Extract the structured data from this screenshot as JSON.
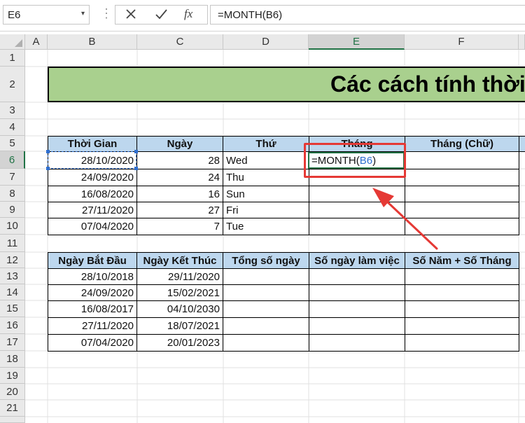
{
  "formula_bar": {
    "name_box": "E6",
    "name_box_dropdown": "▾",
    "separator_dots": "⋮",
    "cancel_icon": "x-icon",
    "enter_icon": "check-icon",
    "fx_label": "fx",
    "formula": "=MONTH(B6)"
  },
  "columns": [
    "A",
    "B",
    "C",
    "D",
    "E",
    "F"
  ],
  "rows": [
    "1",
    "2",
    "3",
    "4",
    "5",
    "6",
    "7",
    "8",
    "9",
    "10",
    "11",
    "12",
    "13",
    "14",
    "15",
    "16",
    "17",
    "18",
    "19",
    "20",
    "21"
  ],
  "selected_cell": "E6",
  "title": "Các cách tính thời",
  "table1": {
    "headers": [
      "Thời Gian",
      "Ngày",
      "Thứ",
      "Tháng",
      "Tháng (Chữ)"
    ],
    "rows": [
      {
        "date": "28/10/2020",
        "day": "28",
        "weekday": "Wed"
      },
      {
        "date": "24/09/2020",
        "day": "24",
        "weekday": "Thu"
      },
      {
        "date": "16/08/2020",
        "day": "16",
        "weekday": "Sun"
      },
      {
        "date": "27/11/2020",
        "day": "27",
        "weekday": "Fri"
      },
      {
        "date": "07/04/2020",
        "day": "7",
        "weekday": "Tue"
      }
    ]
  },
  "editing": {
    "prefix": "=MONTH(",
    "ref": "B6",
    "suffix": ")"
  },
  "table2": {
    "headers": [
      "Ngày Bắt Đầu",
      "Ngày Kết Thúc",
      "Tổng số ngày",
      "Số ngày làm việc",
      "Số Năm + Số Tháng"
    ],
    "rows": [
      {
        "start": "28/10/2018",
        "end": "29/11/2020"
      },
      {
        "start": "24/09/2020",
        "end": "15/02/2021"
      },
      {
        "start": "16/08/2017",
        "end": "04/10/2030"
      },
      {
        "start": "27/11/2020",
        "end": "18/07/2021"
      },
      {
        "start": "07/04/2020",
        "end": "20/01/2023"
      }
    ]
  },
  "colors": {
    "title_fill": "#a9d08e",
    "header_fill": "#bdd7ee",
    "annotation": "#e53935",
    "selection": "#217346"
  }
}
